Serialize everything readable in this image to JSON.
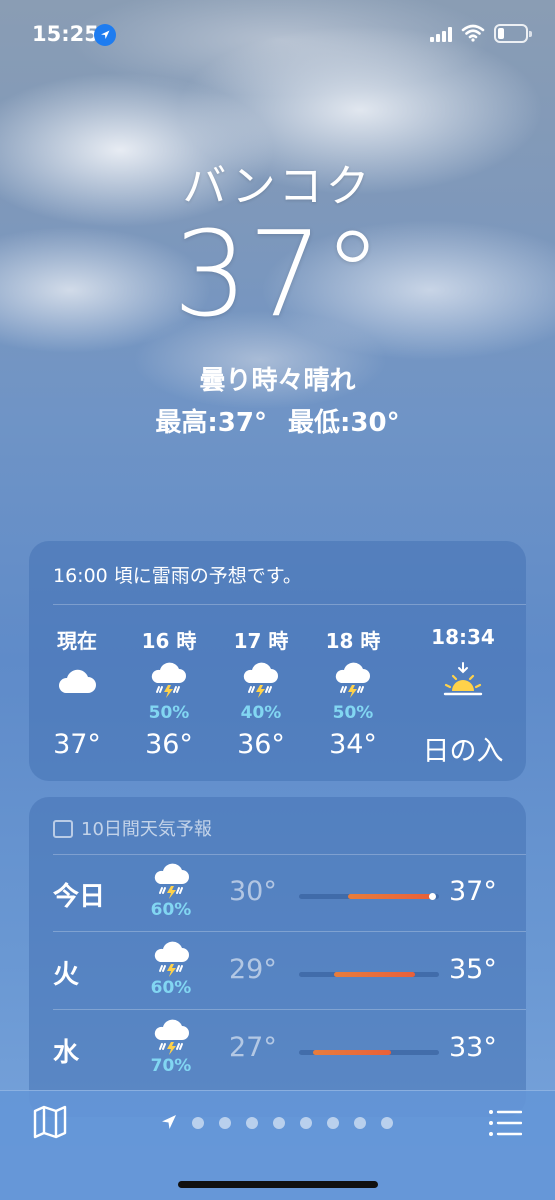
{
  "status_bar": {
    "time": "15:25"
  },
  "location": {
    "city": "バンコク",
    "temperature": "37°",
    "condition": "曇り時々晴れ",
    "high": "最高:37°",
    "low": "最低:30°"
  },
  "hourly": {
    "alert": "16:00 頃に雷雨の予想です。",
    "items": [
      {
        "label": "現在",
        "icon": "cloud-icon",
        "pop": "",
        "temp": "37°"
      },
      {
        "label": "16 時",
        "icon": "thunderstorm-icon",
        "pop": "50%",
        "temp": "36°"
      },
      {
        "label": "17 時",
        "icon": "thunderstorm-icon",
        "pop": "40%",
        "temp": "36°"
      },
      {
        "label": "18 時",
        "icon": "thunderstorm-icon",
        "pop": "50%",
        "temp": "34°"
      },
      {
        "label": "18:34",
        "icon": "sunset-icon",
        "pop": "",
        "temp": "日の入"
      }
    ]
  },
  "daily": {
    "header": "10日間天気予報",
    "days": [
      {
        "day": "今日",
        "icon": "thunderstorm-icon",
        "pop": "60%",
        "low": "30°",
        "high": "37°",
        "range_start": 0.35,
        "range_end": 0.95,
        "current": 0.95
      },
      {
        "day": "火",
        "icon": "thunderstorm-icon",
        "pop": "60%",
        "low": "29°",
        "high": "35°",
        "range_start": 0.25,
        "range_end": 0.83
      },
      {
        "day": "水",
        "icon": "thunderstorm-icon",
        "pop": "70%",
        "low": "27°",
        "high": "33°",
        "range_start": 0.1,
        "range_end": 0.66
      }
    ]
  },
  "toolbar": {
    "pages": 8
  },
  "colors": {
    "pop": "#82d6f2",
    "range": "#e8603a",
    "location_dot": "#1e7cf0"
  }
}
